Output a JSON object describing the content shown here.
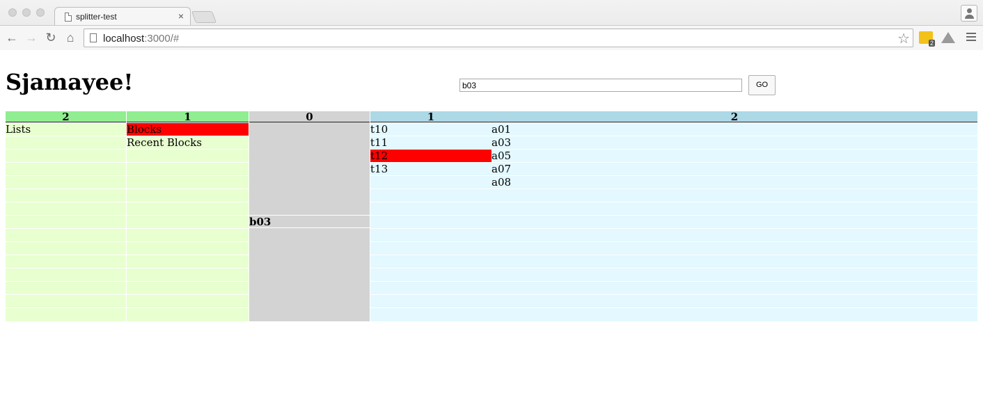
{
  "browser": {
    "tab_title": "splitter-test",
    "tab_close": "×",
    "url_host": "localhost",
    "url_rest": ":3000/#",
    "extension_badge": "2"
  },
  "page": {
    "title": "Sjamayee!",
    "search_value": "b03",
    "go_label": "GO"
  },
  "columns": {
    "left2": {
      "header": "2",
      "rows": [
        "Lists"
      ]
    },
    "left1": {
      "header": "1",
      "rows": [
        "Blocks",
        "Recent Blocks"
      ],
      "selected": "Blocks"
    },
    "center": {
      "header": "0",
      "selected_item": "b03"
    },
    "right1": {
      "header": "1",
      "rows": [
        "t10",
        "t11",
        "t12",
        "t13"
      ],
      "selected": "t12"
    },
    "right2": {
      "header": "2",
      "rows": [
        "a01",
        "a03",
        "a05",
        "a07",
        "a08"
      ]
    }
  },
  "colors": {
    "left_header": "#90ee90",
    "left_body": "#e8ffd0",
    "center": "#d3d3d3",
    "right_header": "#add8e6",
    "right_body": "#e3f8ff",
    "selection": "#ff0000"
  }
}
